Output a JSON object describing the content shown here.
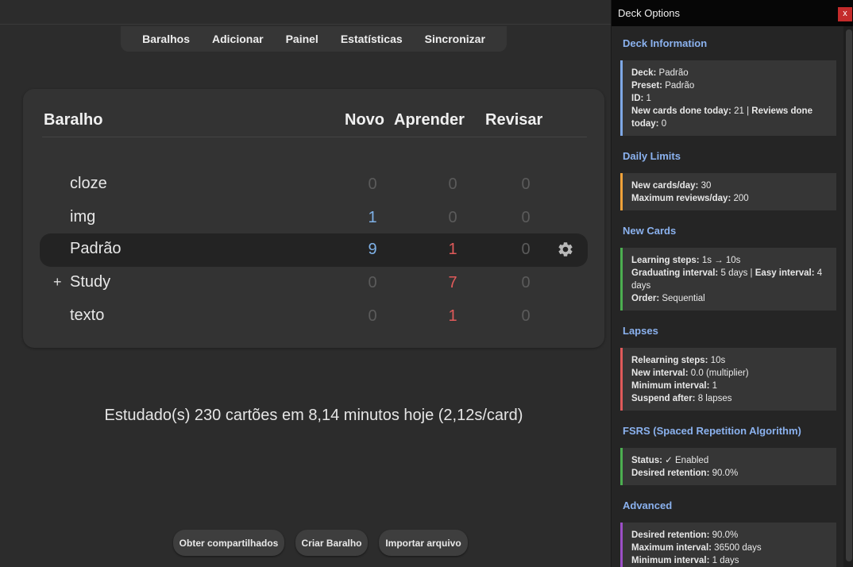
{
  "nav": {
    "items": [
      "Baralhos",
      "Adicionar",
      "Painel",
      "Estatísticas",
      "Sincronizar"
    ]
  },
  "table": {
    "headers": {
      "deck": "Baralho",
      "new": "Novo",
      "learn": "Aprender",
      "review": "Revisar"
    },
    "rows": [
      {
        "name": "cloze",
        "expander": "",
        "new": "0",
        "learn": "0",
        "review": "0"
      },
      {
        "name": "img",
        "expander": "",
        "new": "1",
        "learn": "0",
        "review": "0"
      },
      {
        "name": "Padrão",
        "expander": "",
        "new": "9",
        "learn": "1",
        "review": "0"
      },
      {
        "name": "Study",
        "expander": "+",
        "new": "0",
        "learn": "7",
        "review": "0"
      },
      {
        "name": "texto",
        "expander": "",
        "new": "0",
        "learn": "1",
        "review": "0"
      }
    ],
    "selected_row": "Padrão",
    "gear_icon": "gear-icon"
  },
  "studied_text": "Estudado(s) 230 cartões em 8,14 minutos hoje (2,12s/card)",
  "buttons": {
    "shared": "Obter compartilhados",
    "create": "Criar Baralho",
    "import": "Importar arquivo"
  },
  "panel": {
    "title": "Deck Options",
    "close": "x",
    "sections": {
      "info": {
        "title": "Deck Information",
        "deck_label": "Deck:",
        "deck_value": " Padrão",
        "preset_label": "Preset:",
        "preset_value": " Padrão",
        "id_label": "ID:",
        "id_value": " 1",
        "newdone_label": "New cards done today:",
        "newdone_value": " 21 | ",
        "reviews_label": "Reviews done today:",
        "reviews_value": " 0"
      },
      "limits": {
        "title": "Daily Limits",
        "new_label": "New cards/day:",
        "new_value": " 30",
        "rev_label": "Maximum reviews/day:",
        "rev_value": " 200"
      },
      "newcards": {
        "title": "New Cards",
        "steps_label": "Learning steps:",
        "steps_value": " 1s → 10s",
        "grad_label": "Graduating interval:",
        "grad_value": " 5 days | ",
        "easy_label": "Easy interval:",
        "easy_value": " 4 days",
        "order_label": "Order:",
        "order_value": " Sequential"
      },
      "lapses": {
        "title": "Lapses",
        "relearn_label": "Relearning steps:",
        "relearn_value": " 10s",
        "newint_label": "New interval:",
        "newint_value": " 0.0 (multiplier)",
        "minint_label": "Minimum interval:",
        "minint_value": " 1",
        "suspend_label": "Suspend after:",
        "suspend_value": " 8 lapses"
      },
      "fsrs": {
        "title": "FSRS (Spaced Repetition Algorithm)",
        "status_label": "Status:",
        "status_value": " ✓ Enabled",
        "ret_label": "Desired retention:",
        "ret_value": " 90.0%"
      },
      "advanced": {
        "title": "Advanced",
        "ret_label": "Desired retention:",
        "ret_value": " 90.0%",
        "maxint_label": "Maximum interval:",
        "maxint_value": " 36500 days",
        "minint_label": "Minimum interval:",
        "minint_value": " 1 days"
      }
    }
  },
  "colors": {
    "accent_blue": "#7fb2e8",
    "red": "#e05a5a",
    "section_title": "#8bb2ef",
    "info_border": "#7fa8e6",
    "limits_border": "#f0a23a",
    "newcards_border": "#4caf50",
    "lapses_border": "#e05a5a",
    "fsrs_border": "#4caf50",
    "advanced_border": "#9c4fc7"
  }
}
